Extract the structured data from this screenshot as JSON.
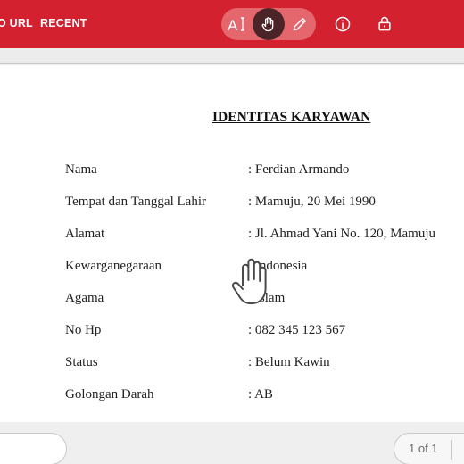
{
  "nav": {
    "url_label": "O URL",
    "recent_label": "RECENT"
  },
  "toolbar": {
    "tools": [
      {
        "name": "text-select",
        "icon": "text-cursor-icon",
        "active": false
      },
      {
        "name": "pan",
        "icon": "hand-icon",
        "active": true
      },
      {
        "name": "annotate",
        "icon": "pencil-icon",
        "active": false
      }
    ],
    "right_icons": [
      "info-icon",
      "lock-icon"
    ],
    "colors": {
      "bar": "#d3212f",
      "pill": "#e5676e",
      "active": "#4a2426"
    }
  },
  "document": {
    "title": "IDENTITAS KARYAWAN",
    "rows": [
      {
        "label": "Nama",
        "value": ": Ferdian Armando"
      },
      {
        "label": "Tempat dan Tanggal Lahir",
        "value": ": Mamuju, 20 Mei 1990"
      },
      {
        "label": "Alamat",
        "value": ": Jl. Ahmad Yani No. 120, Mamuju"
      },
      {
        "label": "Kewarganegaraan",
        "value": ": Indonesia"
      },
      {
        "label": "Agama",
        "value": ": Islam"
      },
      {
        "label": "No Hp",
        "value": ": 082 345 123 567"
      },
      {
        "label": "Status",
        "value": ": Belum Kawin"
      },
      {
        "label": "Golongan Darah",
        "value": ": AB"
      }
    ]
  },
  "pagination": {
    "text": "1 of 1"
  },
  "cursor": {
    "icon": "hand-cursor-icon"
  }
}
